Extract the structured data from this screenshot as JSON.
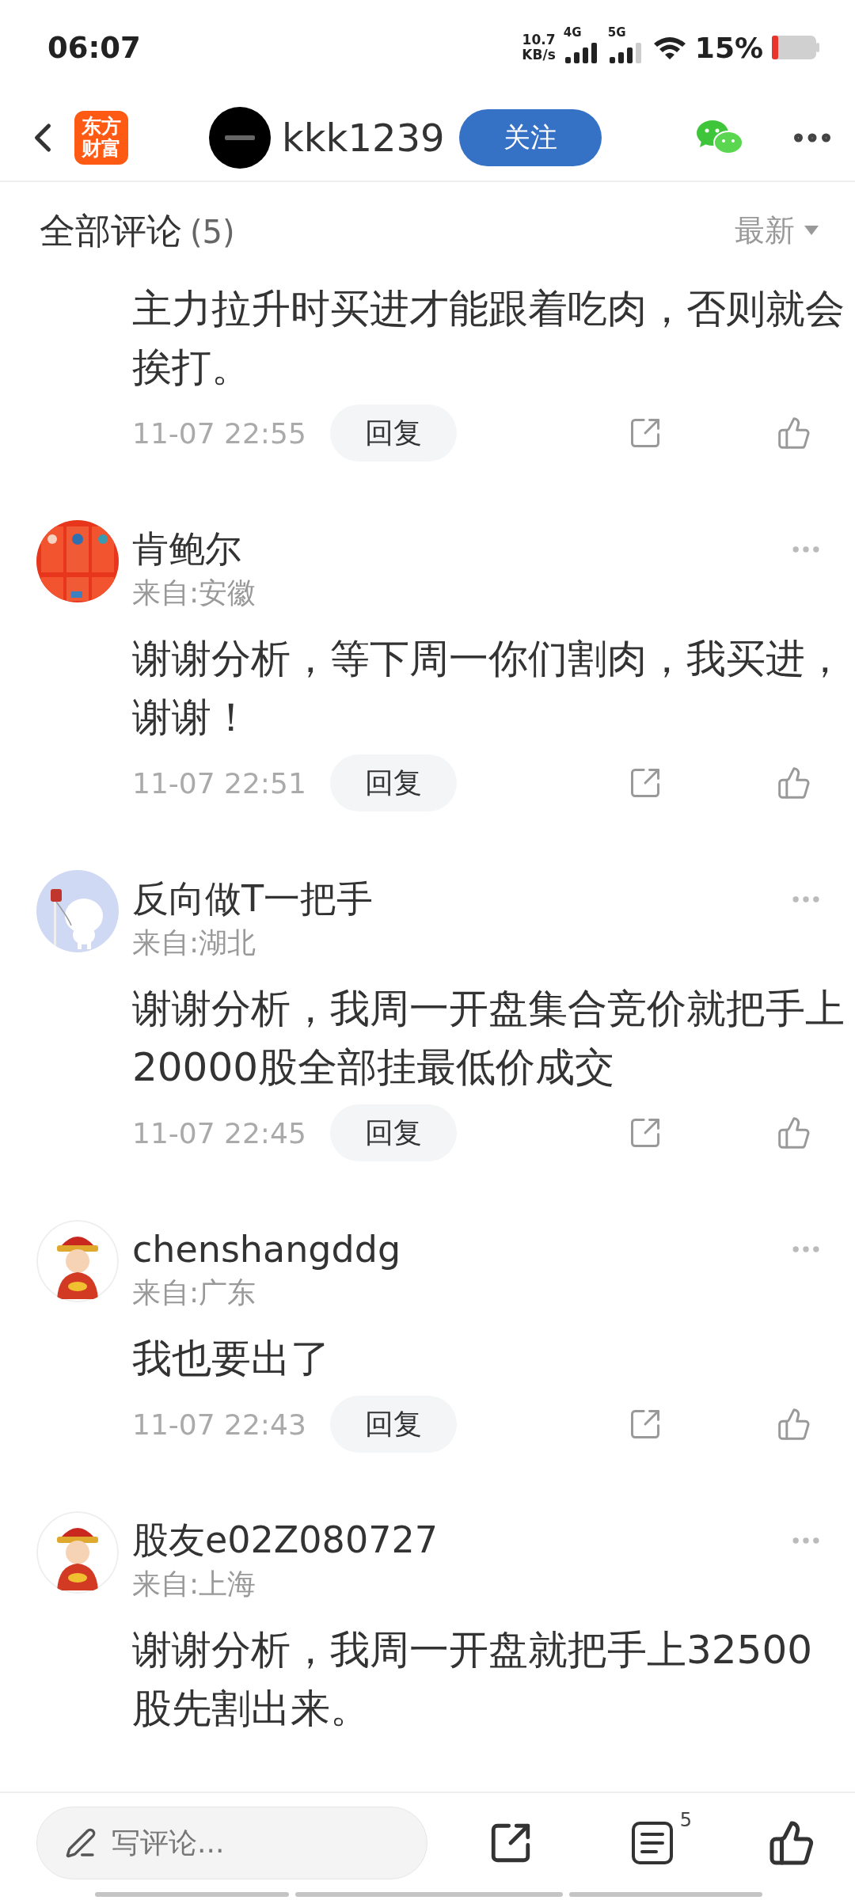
{
  "status_bar": {
    "time": "06:07",
    "net_speed": "10.7",
    "net_unit": "KB/s",
    "sim1": "4G",
    "sim2": "5G",
    "battery": "15%"
  },
  "header": {
    "logo": [
      "东方",
      "财富"
    ],
    "username": "kkk1239",
    "follow_button": "关注"
  },
  "comments_header": {
    "title": "全部评论",
    "count": "(5)",
    "sort": "最新"
  },
  "comments": [
    {
      "text": "主力拉升时买进才能跟着吃肉，否则就会挨打。",
      "time": "11-07 22:55",
      "reply": "回复"
    },
    {
      "name": "肯鲍尔",
      "location": "来自:安徽",
      "text": "谢谢分析，等下周一你们割肉，我买进，谢谢！",
      "time": "11-07 22:51",
      "reply": "回复"
    },
    {
      "name": "反向做T一把手",
      "location": "来自:湖北",
      "text": "谢谢分析，我周一开盘集合竞价就把手上20000股全部挂最低价成交",
      "time": "11-07 22:45",
      "reply": "回复"
    },
    {
      "name": "chenshangddg",
      "location": "来自:广东",
      "text": "我也要出了",
      "time": "11-07 22:43",
      "reply": "回复"
    },
    {
      "name": "股友e02Z080727",
      "location": "来自:上海",
      "text": "谢谢分析，我周一开盘就把手上32500股先割出来。"
    }
  ],
  "bottom_bar": {
    "placeholder": "写评论...",
    "comment_count": "5"
  }
}
